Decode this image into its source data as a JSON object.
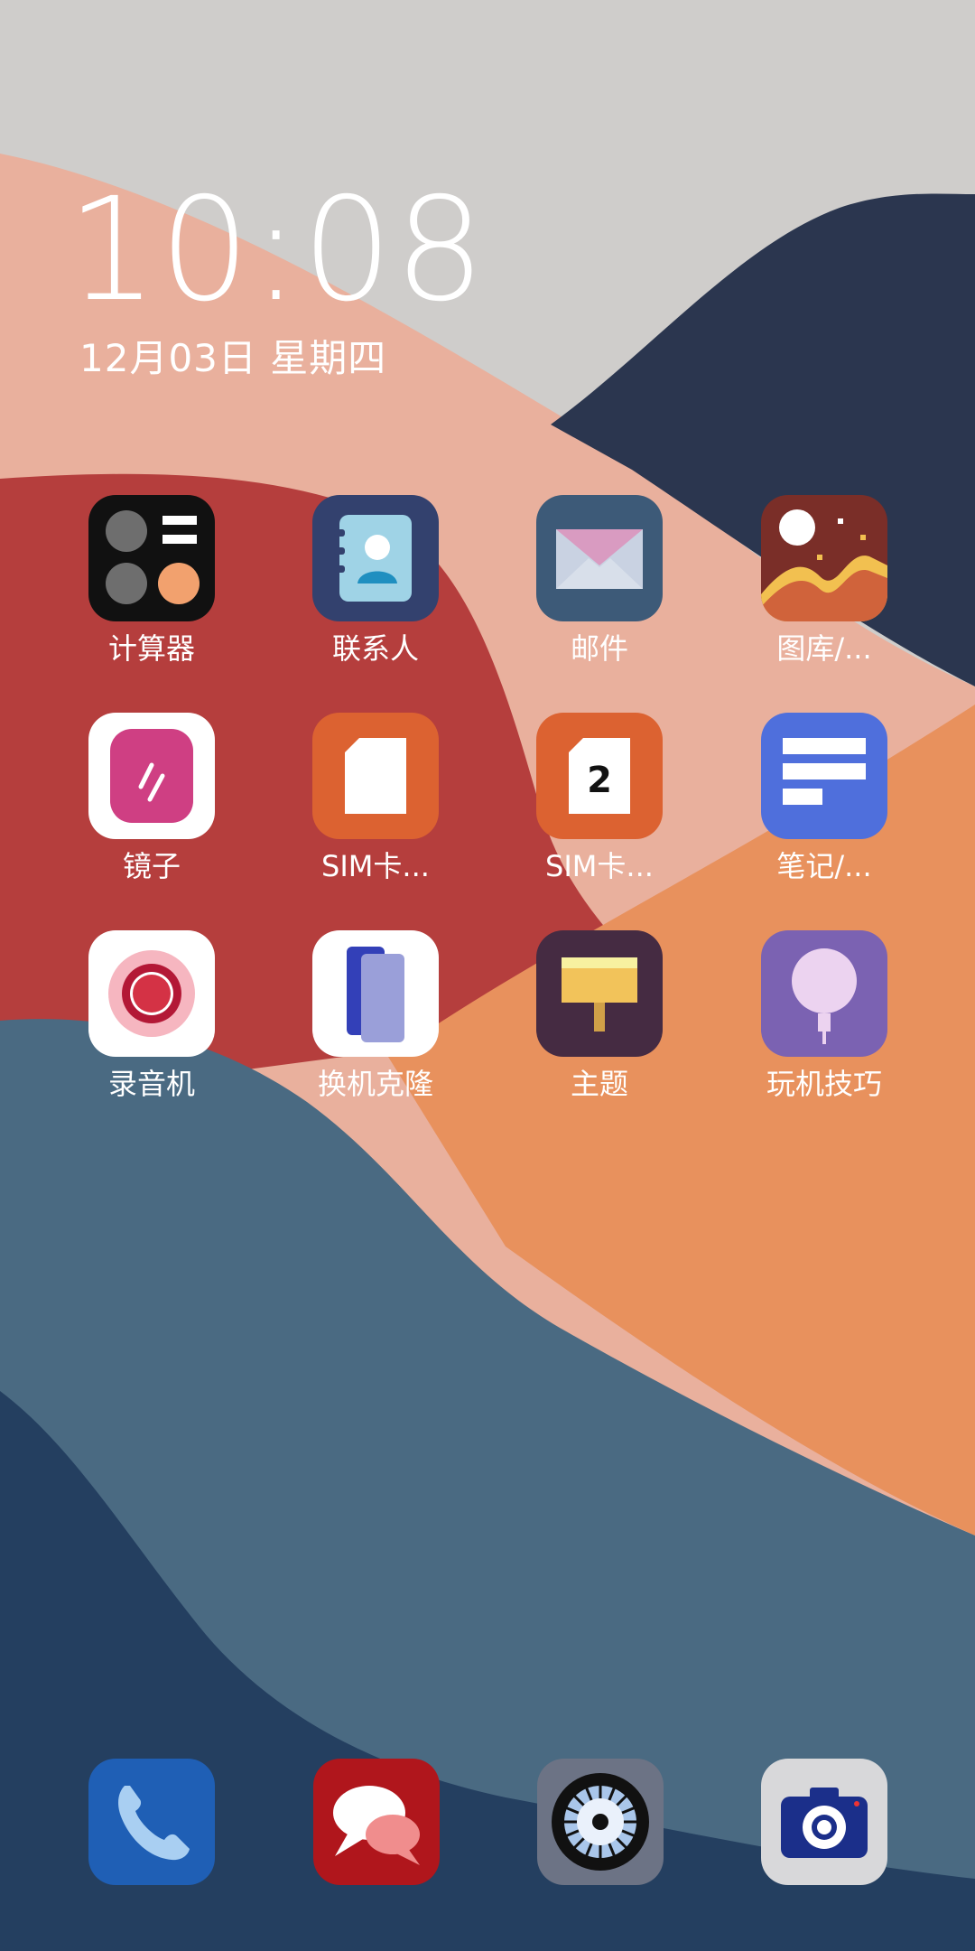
{
  "status": {
    "time": "10:08",
    "date": "12月03日 星期四"
  },
  "apps": [
    {
      "label": "计算器",
      "icon": "calculator-icon"
    },
    {
      "label": "联系人",
      "icon": "contacts-icon"
    },
    {
      "label": "邮件",
      "icon": "mail-icon"
    },
    {
      "label": "图库/...",
      "icon": "gallery-icon"
    },
    {
      "label": "镜子",
      "icon": "mirror-icon"
    },
    {
      "label": "SIM卡...",
      "icon": "sim-card-icon"
    },
    {
      "label": "SIM卡...",
      "icon": "sim-card-2-icon"
    },
    {
      "label": "笔记/...",
      "icon": "notes-icon"
    },
    {
      "label": "录音机",
      "icon": "recorder-icon"
    },
    {
      "label": "换机克隆",
      "icon": "phone-clone-icon"
    },
    {
      "label": "主题",
      "icon": "themes-icon"
    },
    {
      "label": "玩机技巧",
      "icon": "tips-icon"
    }
  ],
  "sim2_badge": "2",
  "dock": [
    {
      "icon": "phone-icon"
    },
    {
      "icon": "messages-icon"
    },
    {
      "icon": "settings-icon"
    },
    {
      "icon": "camera-icon"
    }
  ],
  "colors": {
    "sky": "#cfcdcb",
    "peach": "#e9b09d",
    "red": "#b53e3d",
    "navy": "#2b364f",
    "orange": "#e8915d",
    "slate": "#4a6a82",
    "deep_blue": "#243f60"
  }
}
